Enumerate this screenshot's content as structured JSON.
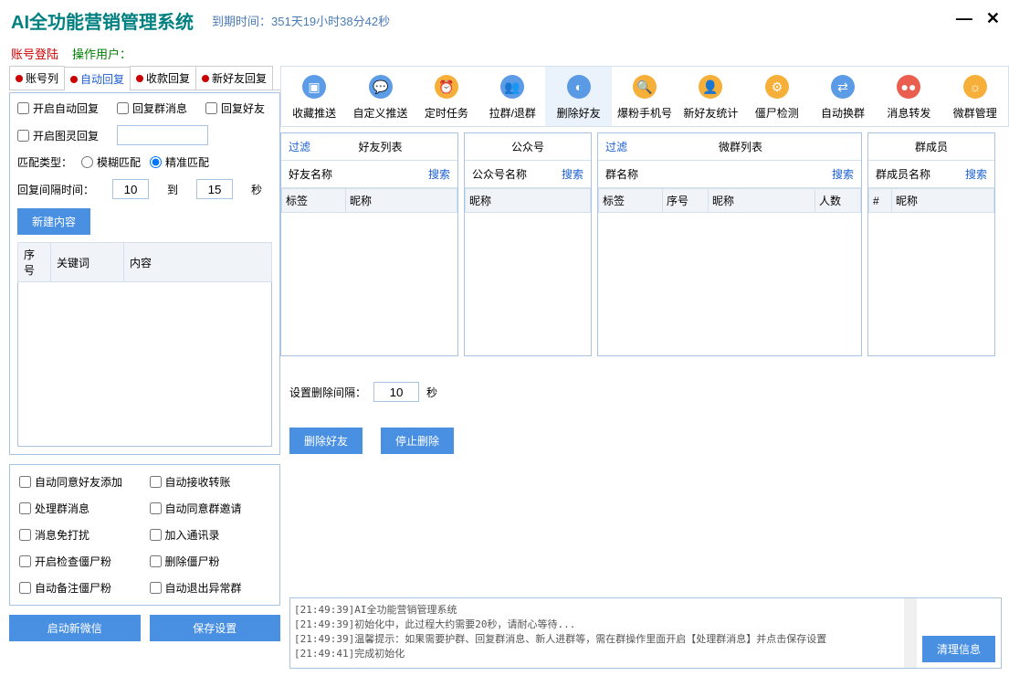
{
  "header": {
    "title": "AI全功能营销管理系统",
    "countdown_label": "到期时间：",
    "countdown_value": "351天19小时38分42秒"
  },
  "subheader": {
    "login": "账号登陆",
    "user_label": "操作用户："
  },
  "tabs": [
    "账号列",
    "自动回复",
    "收款回复",
    "新好友回复"
  ],
  "active_tab": 1,
  "auto_reply": {
    "chk_enable": "开启自动回复",
    "chk_group_msg": "回复群消息",
    "chk_friend": "回复好友",
    "chk_tuling": "开启图灵回复",
    "match_type_label": "匹配类型：",
    "radio_fuzzy": "模糊匹配",
    "radio_exact": "精准匹配",
    "interval_label": "回复间隔时间：",
    "interval_from": "10",
    "interval_to": "15",
    "interval_unit": "秒",
    "to_label": "到",
    "btn_new": "新建内容",
    "col_seq": "序号",
    "col_keyword": "关键词",
    "col_content": "内容"
  },
  "lower_checks": {
    "auto_accept_friend": "自动同意好友添加",
    "auto_accept_transfer": "自动接收转账",
    "process_group_msg": "处理群消息",
    "auto_accept_group_invite": "自动同意群邀请",
    "dnd": "消息免打扰",
    "add_contacts": "加入通讯录",
    "check_zombie": "开启检查僵尸粉",
    "delete_zombie": "删除僵尸粉",
    "backup_zombie": "自动备注僵尸粉",
    "exit_abnormal_group": "自动退出异常群"
  },
  "bottom_buttons": {
    "start_wechat": "启动新微信",
    "save_settings": "保存设置"
  },
  "toolbar": [
    {
      "label": "收藏推送",
      "color": "#4a90e2"
    },
    {
      "label": "自定义推送",
      "color": "#4a90e2"
    },
    {
      "label": "定时任务",
      "color": "#f5a623"
    },
    {
      "label": "拉群/退群",
      "color": "#4a90e2"
    },
    {
      "label": "删除好友",
      "color": "#4a90e2",
      "active": true
    },
    {
      "label": "爆粉手机号",
      "color": "#f5a623"
    },
    {
      "label": "新好友统计",
      "color": "#f5a623"
    },
    {
      "label": "僵尸检测",
      "color": "#f5a623"
    },
    {
      "label": "自动换群",
      "color": "#4a90e2"
    },
    {
      "label": "消息转发",
      "color": "#e74c3c"
    },
    {
      "label": "微群管理",
      "color": "#f5a623"
    }
  ],
  "panels": {
    "friends": {
      "filter": "过滤",
      "title": "好友列表",
      "search_label": "好友名称",
      "search": "搜索",
      "cols": [
        "标签",
        "昵称"
      ]
    },
    "public": {
      "title": "公众号",
      "search_label": "公众号名称",
      "search": "搜索",
      "cols": [
        "昵称"
      ]
    },
    "groups": {
      "filter": "过滤",
      "title": "微群列表",
      "search_label": "群名称",
      "search": "搜索",
      "cols": [
        "标签",
        "序号",
        "昵称",
        "人数"
      ]
    },
    "members": {
      "title": "群成员",
      "search_label": "群成员名称",
      "search": "搜索",
      "cols": [
        "#",
        "昵称"
      ]
    }
  },
  "delete_controls": {
    "interval_label": "设置删除间隔：",
    "interval_value": "10",
    "unit": "秒",
    "btn_delete": "删除好友",
    "btn_stop": "停止删除"
  },
  "log": {
    "lines": "[21:49:39]AI全功能营销管理系统\n[21:49:39]初始化中，此过程大约需要20秒，请耐心等待...\n[21:49:39]温馨提示：如果需要护群、回复群消息、新人进群等，需在群操作里面开启【处理群消息】并点击保存设置\n[21:49:41]完成初始化",
    "clear": "清理信息"
  }
}
